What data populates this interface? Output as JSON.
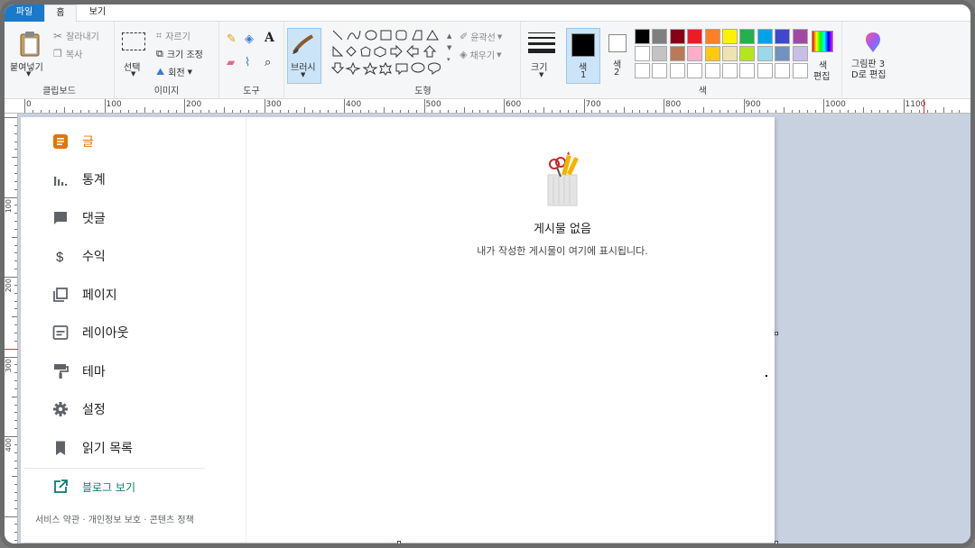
{
  "tabs": {
    "file": "파일",
    "home": "홈",
    "view": "보기"
  },
  "ribbon": {
    "clipboard": {
      "paste": "붙여넣기",
      "cut": "잘라내기",
      "copy": "복사",
      "label": "클립보드"
    },
    "image": {
      "select": "선택",
      "crop": "자르기",
      "resize": "크기 조정",
      "rotate": "회전",
      "label": "이미지"
    },
    "tools": {
      "label": "도구"
    },
    "brushes": {
      "label": "브러시"
    },
    "shapes": {
      "outline": "윤곽선",
      "fill": "채우기",
      "label": "도형"
    },
    "size": {
      "label": "크기"
    },
    "colors": {
      "color1": "색\n1",
      "color1_a": "색",
      "color1_b": "1",
      "color2_a": "색",
      "color2_b": "2",
      "edit_a": "색",
      "edit_b": "편집",
      "label": "색",
      "palette_row1": [
        "#000000",
        "#7f7f7f",
        "#880015",
        "#ed1c24",
        "#ff7f27",
        "#fff200",
        "#22b14c",
        "#00a2e8",
        "#3f48cc",
        "#a349a4"
      ],
      "palette_row2": [
        "#ffffff",
        "#c3c3c3",
        "#b97a57",
        "#ffaec9",
        "#ffc90e",
        "#efe4b0",
        "#b5e61d",
        "#99d9ea",
        "#7092be",
        "#c8bfe7"
      ]
    },
    "paint3d_a": "그림판 3",
    "paint3d_b": "D로 편집"
  },
  "ruler": {
    "ticks": [
      "0",
      "100",
      "200",
      "300",
      "400",
      "500",
      "600",
      "700",
      "800",
      "900",
      "1000",
      "1100"
    ],
    "left_ticks": [
      "100",
      "200",
      "300",
      "400"
    ]
  },
  "blog": {
    "nav": [
      {
        "label": "글",
        "icon": "posts-icon",
        "active": true
      },
      {
        "label": "통계",
        "icon": "stats-icon"
      },
      {
        "label": "댓글",
        "icon": "comments-icon"
      },
      {
        "label": "수익",
        "icon": "dollar-icon"
      },
      {
        "label": "페이지",
        "icon": "pages-icon"
      },
      {
        "label": "레이아웃",
        "icon": "layout-icon"
      },
      {
        "label": "테마",
        "icon": "theme-roller-icon"
      },
      {
        "label": "설정",
        "icon": "gear-icon"
      },
      {
        "label": "읽기 목록",
        "icon": "bookmark-icon"
      }
    ],
    "view_blog": "블로그 보기",
    "footer": "서비스 약관 · 개인정보 보호 · 콘텐츠 정책",
    "empty_title": "게시물 없음",
    "empty_sub": "내가 작성한 게시물이 여기에 표시됩니다."
  },
  "accent": "#e37400",
  "link_color": "#0b7a6b"
}
